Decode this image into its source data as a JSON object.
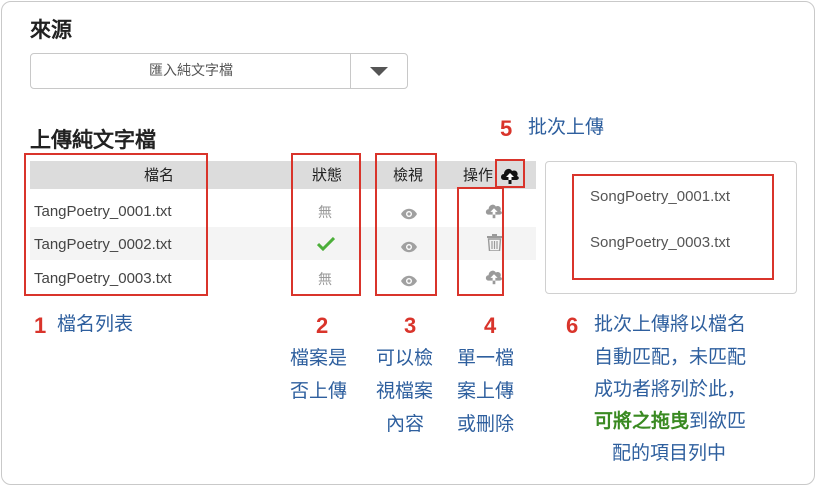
{
  "source": {
    "heading": "來源",
    "select_value": "匯入純文字檔"
  },
  "upload": {
    "heading": "上傳純文字檔",
    "columns": {
      "name": "檔名",
      "status": "狀態",
      "view": "檢視",
      "action": "操作"
    },
    "rows": [
      {
        "name": "TangPoetry_0001.txt",
        "status": "無",
        "status_icon": "none-text",
        "view_icon": "eye-icon",
        "action_icon": "cloud-upload-icon"
      },
      {
        "name": "TangPoetry_0002.txt",
        "status": "",
        "status_icon": "check-icon",
        "view_icon": "eye-icon",
        "action_icon": "trash-icon"
      },
      {
        "name": "TangPoetry_0003.txt",
        "status": "無",
        "status_icon": "none-text",
        "view_icon": "eye-icon",
        "action_icon": "cloud-upload-icon"
      }
    ],
    "batch_upload_icon": "cloud-upload-black-icon"
  },
  "unmatched_panel": {
    "files": [
      "SongPoetry_0001.txt",
      "SongPoetry_0003.txt"
    ]
  },
  "annotations": {
    "a1": {
      "num": "1",
      "text": "檔名列表"
    },
    "a2": {
      "num": "2",
      "lines": [
        "檔案是",
        "否上傳"
      ]
    },
    "a3": {
      "num": "3",
      "lines": [
        "可以檢",
        "視檔案",
        "內容"
      ]
    },
    "a4": {
      "num": "4",
      "lines": [
        "單一檔",
        "案上傳",
        "或刪除"
      ]
    },
    "a5": {
      "num": "5",
      "text": "批次上傳"
    },
    "a6": {
      "num": "6",
      "lines": [
        "批次上傳將以檔名",
        "自動匹配，未匹配",
        "成功者將列於此，"
      ],
      "highlight": "可將之拖曳",
      "line4_rest": "到欲匹",
      "line5": "配的項目列中"
    }
  },
  "colors": {
    "annotation_red": "#d9342b",
    "annotation_blue": "#2e5f9e",
    "highlight_green": "#3a8a22",
    "check_green": "#4caf3a"
  }
}
